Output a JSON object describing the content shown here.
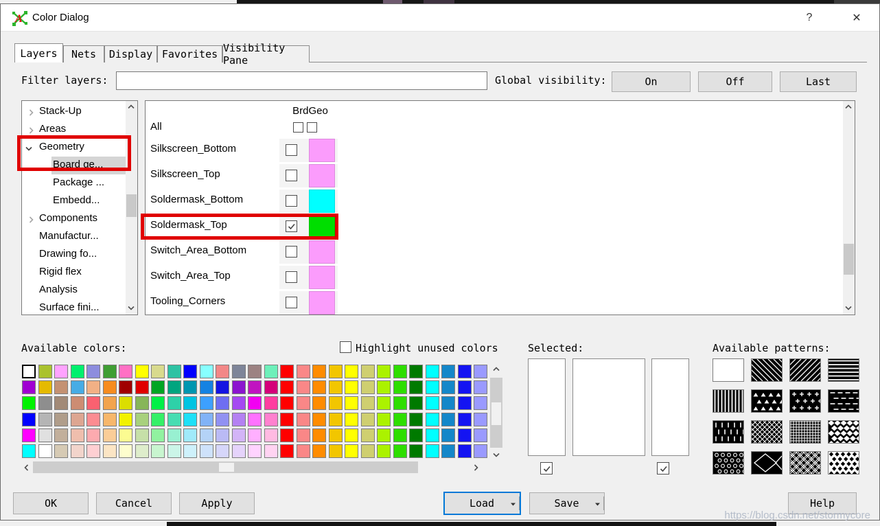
{
  "window": {
    "title": "Color Dialog",
    "help_glyph": "?",
    "close_glyph": "✕"
  },
  "tabs": [
    {
      "label": "Layers",
      "active": true
    },
    {
      "label": "Nets",
      "active": false
    },
    {
      "label": "Display",
      "active": false
    },
    {
      "label": "Favorites",
      "active": false
    },
    {
      "label": "Visibility Pane",
      "active": false
    }
  ],
  "filter": {
    "label": "Filter layers:",
    "value": "",
    "placeholder": ""
  },
  "global_visibility": {
    "label": "Global visibility:",
    "buttons": [
      "On",
      "Off",
      "Last"
    ]
  },
  "layer_tree": {
    "items": [
      {
        "label": "Stack-Up",
        "state": "collapsed",
        "level": 0,
        "selected": false
      },
      {
        "label": "Areas",
        "state": "collapsed",
        "level": 0,
        "selected": false
      },
      {
        "label": "Geometry",
        "state": "expanded",
        "level": 0,
        "selected": false,
        "annotated": true
      },
      {
        "label": "Board ge...",
        "state": "none",
        "level": 1,
        "selected": true,
        "annotated": true
      },
      {
        "label": "Package ...",
        "state": "none",
        "level": 1,
        "selected": false
      },
      {
        "label": "Embedd...",
        "state": "none",
        "level": 1,
        "selected": false
      },
      {
        "label": "Components",
        "state": "collapsed",
        "level": 0,
        "selected": false
      },
      {
        "label": "Manufactur...",
        "state": "none",
        "level": 0,
        "selected": false
      },
      {
        "label": "Drawing fo...",
        "state": "none",
        "level": 0,
        "selected": false
      },
      {
        "label": "Rigid flex",
        "state": "none",
        "level": 0,
        "selected": false
      },
      {
        "label": "Analysis",
        "state": "none",
        "level": 0,
        "selected": false
      },
      {
        "label": "Surface fini...",
        "state": "none",
        "level": 0,
        "selected": false
      }
    ]
  },
  "layer_table": {
    "group_header": "BrdGeo",
    "all_label": "All",
    "header_checkbox_1_checked": false,
    "header_checkbox_2_checked": false,
    "rows": [
      {
        "name": "Silkscreen_Bottom",
        "checked": false,
        "color": "#fb9cfc",
        "annotated": false
      },
      {
        "name": "Silkscreen_Top",
        "checked": false,
        "color": "#fb9cfc",
        "annotated": false
      },
      {
        "name": "Soldermask_Bottom",
        "checked": false,
        "color": "#00ffff",
        "annotated": false
      },
      {
        "name": "Soldermask_Top",
        "checked": true,
        "color": "#00de00",
        "annotated": true
      },
      {
        "name": "Switch_Area_Bottom",
        "checked": false,
        "color": "#fb9cfc",
        "annotated": false
      },
      {
        "name": "Switch_Area_Top",
        "checked": false,
        "color": "#fb9cfc",
        "annotated": false
      },
      {
        "name": "Tooling_Corners",
        "checked": false,
        "color": "#fb9cfc",
        "annotated": false
      }
    ]
  },
  "available_colors": {
    "label": "Available colors:",
    "highlight_label": "Highlight unused colors",
    "highlight_checked": false,
    "selected_cell": {
      "row": 0,
      "col": 0
    },
    "palette_rows": [
      [
        "#ffffff",
        "#aac22e",
        "#ffa3ff",
        "#00f06e",
        "#8d8dde",
        "#3f9e33",
        "#ff70c4",
        "#ffff00",
        "#d8da8d",
        "#2ec2a3",
        "#0000ff",
        "#87ffff",
        "#f28787",
        "#7e8599",
        "#9c8282",
        "#6ef0ba",
        "#ff0000",
        "#fa8787",
        "#ff8c00",
        "#f2c600",
        "#ffff00",
        "#cfcf70",
        "#abf200",
        "#2ede00",
        "#007a00",
        "#00ffff",
        "#1487c9",
        "#1414f2",
        "#9a9aff"
      ],
      [
        "#a000d2",
        "#e5ba00",
        "#c49172",
        "#47ace5",
        "#f2b085",
        "#f78c1f",
        "#a00000",
        "#e00000",
        "#00a523",
        "#00a57f",
        "#0096b0",
        "#1482e2",
        "#1414e2",
        "#8b14cf",
        "#c014c0",
        "#d40079",
        "#ff0000",
        "#fa8787",
        "#ff8c00",
        "#f2c600",
        "#ffff00",
        "#cfcf70",
        "#abf200",
        "#2ede00",
        "#007a00",
        "#00ffff",
        "#1487c9",
        "#1414f2",
        "#9a9aff"
      ],
      [
        "#00f200",
        "#8e8e8e",
        "#a28a77",
        "#cd8c72",
        "#fa6170",
        "#f2a44e",
        "#dbde00",
        "#87b659",
        "#00f046",
        "#2ed1a8",
        "#00c4e2",
        "#3da0ff",
        "#6e6ef2",
        "#a549f2",
        "#f200f2",
        "#ff3da0",
        "#ff0000",
        "#fa8787",
        "#ff8c00",
        "#f2c600",
        "#ffff00",
        "#cfcf70",
        "#abf200",
        "#2ede00",
        "#007a00",
        "#00ffff",
        "#1487c9",
        "#1414f2",
        "#9a9aff"
      ],
      [
        "#0000ff",
        "#b5b5b5",
        "#b09d8a",
        "#dda691",
        "#fc8c91",
        "#f7b76b",
        "#f2f200",
        "#a8d17d",
        "#35f068",
        "#47ddb2",
        "#1fe0f7",
        "#81b3f7",
        "#9191f2",
        "#b481f2",
        "#ff72ff",
        "#ff81cf",
        "#ff0000",
        "#fa8787",
        "#ff8c00",
        "#f2c600",
        "#ffff00",
        "#cfcf70",
        "#abf200",
        "#2ede00",
        "#007a00",
        "#00ffff",
        "#1487c9",
        "#1414f2",
        "#9a9aff"
      ],
      [
        "#ff00ff",
        "#e0e0e0",
        "#c2af9b",
        "#efbead",
        "#fdaaaf",
        "#facd98",
        "#fbfb91",
        "#c6e0a8",
        "#91f2a0",
        "#98f0d1",
        "#a0eafa",
        "#b4d3f7",
        "#babaf5",
        "#d3b4f7",
        "#ffafff",
        "#ffbae2",
        "#ff0000",
        "#fa8787",
        "#ff8c00",
        "#f2c600",
        "#ffff00",
        "#cfcf70",
        "#abf200",
        "#2ede00",
        "#007a00",
        "#00ffff",
        "#1487c9",
        "#1414f2",
        "#9a9aff"
      ],
      [
        "#00ffff",
        "#ffffff",
        "#d6cab4",
        "#f2d4cb",
        "#fecfd2",
        "#fbe5c4",
        "#fdfdcd",
        "#deedcb",
        "#c8f5cf",
        "#cbf5e8",
        "#cef1fb",
        "#cee2fb",
        "#d6d6fa",
        "#e5d3fb",
        "#ffd3ff",
        "#ffd3f2",
        "#ff0000",
        "#fa8787",
        "#ff8c00",
        "#f2c600",
        "#ffff00",
        "#cfcf70",
        "#abf200",
        "#2ede00",
        "#007a00",
        "#00ffff",
        "#1487c9",
        "#1414f2",
        "#9a9aff"
      ]
    ]
  },
  "selected_section": {
    "label": "Selected:",
    "left_checkbox_checked": true,
    "right_checkbox_checked": true
  },
  "available_patterns": {
    "label": "Available patterns:",
    "selected_index": 0,
    "patterns": [
      "solid-white",
      "diagonal-lines-back",
      "diagonal-lines-forward",
      "horizontal-lines",
      "vertical-lines",
      "triangles",
      "plus-signs",
      "horizontal-dashes",
      "vertical-dashes",
      "diagonal-crosshatch",
      "grid-mesh",
      "diamond-checker",
      "circles",
      "diamond-outline",
      "double-crosshatch",
      "black-diamonds-on-white"
    ]
  },
  "action_buttons": {
    "ok": "OK",
    "cancel": "Cancel",
    "apply": "Apply",
    "load": "Load",
    "save": "Save",
    "help": "Help"
  },
  "watermark": "https://blog.csdn.net/stormycore",
  "accent_colors": {
    "annotation_red": "#e00000",
    "focus_blue": "#0078d7",
    "selection_gray": "#d5d5d5"
  }
}
